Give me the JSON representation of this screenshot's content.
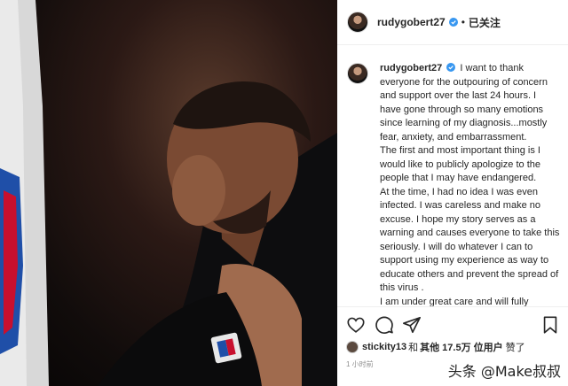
{
  "post": {
    "username": "rudygobert27",
    "follow_separator": "•",
    "follow_label": "已关注",
    "caption_user": "rudygobert27",
    "caption_paragraphs": [
      "I want to thank everyone for the outpouring of concern and support over the last 24 hours. I have gone through so many emotions since learning of my diagnosis...mostly fear, anxiety, and embarrassment.",
      "The first and most important thing is I would like to publicly apologize to the people that I may have endangered.",
      "At the time, I had no idea I was even infected. I was careless and make no excuse. I hope my story serves as a warning and causes everyone to take this seriously. I will do whatever I can to support using my experience as way to educate others and prevent the spread of this virus .",
      "I am under great care and will fully"
    ],
    "likes": {
      "first_user": "stickity13",
      "connector": "和",
      "others": "其他",
      "count": "17.5万",
      "unit": "位用户",
      "suffix": "赞了"
    },
    "time_ago": "1 小时前"
  },
  "photo": {
    "jersey_logo": "NBA"
  },
  "watermark": "头条 @Make叔叔",
  "icons": {
    "verified": "verified-badge-icon",
    "like": "heart-icon",
    "comment": "comment-icon",
    "share": "share-icon",
    "save": "bookmark-icon"
  },
  "colors": {
    "verified": "#3897f0",
    "text": "#262626",
    "muted": "#8e8e8e"
  }
}
